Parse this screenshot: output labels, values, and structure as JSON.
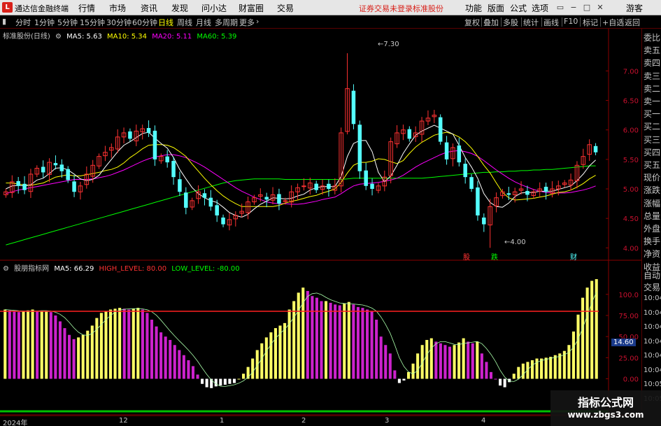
{
  "app": {
    "logo": "L",
    "title": "通达信金融终端"
  },
  "menu": [
    "行情",
    "市场",
    "资讯",
    "发现",
    "问小达",
    "财富圈",
    "交易"
  ],
  "status": {
    "login": "证券交易未登录",
    "stock": "标准股份"
  },
  "right_menu": [
    "功能",
    "版面",
    "公式",
    "选项"
  ],
  "guest": "游客",
  "periods": [
    {
      "label": "分时",
      "active": false
    },
    {
      "label": "1分钟",
      "active": false
    },
    {
      "label": "5分钟",
      "active": false
    },
    {
      "label": "15分钟",
      "active": false
    },
    {
      "label": "30分钟",
      "active": false
    },
    {
      "label": "60分钟",
      "active": false
    },
    {
      "label": "日线",
      "active": true
    },
    {
      "label": "周线",
      "active": false
    },
    {
      "label": "月线",
      "active": false
    },
    {
      "label": "多周期",
      "active": false
    },
    {
      "label": "更多",
      "active": false
    }
  ],
  "tools": [
    "复权",
    "叠加",
    "多股",
    "统计",
    "画线",
    "F10",
    "标记",
    "+自选",
    "返回"
  ],
  "main_legend": {
    "title": "标准股份(日线)",
    "ma5": "MA5: 5.63",
    "ma10": "MA10: 5.34",
    "ma20": "MA20: 5.11",
    "ma60": "MA60: 5.39"
  },
  "indicator_legend": {
    "title": "股朋指标网",
    "ma5": "MA5: 66.29",
    "high": "HIGH_LEVEL: 80.00",
    "low": "LOW_LEVEL: -80.00"
  },
  "annotations": {
    "high_price": "7.30",
    "low_price": "4.00",
    "tag1": "股",
    "tag2": "跌",
    "tag3": "财"
  },
  "sidebar": [
    "委比",
    "卖五",
    "卖四",
    "卖三",
    "卖二",
    "卖一",
    "买一",
    "买二",
    "买三",
    "买四",
    "买五",
    "现价",
    "涨跌",
    "涨幅",
    "总量",
    "外盘",
    "换手",
    "净资",
    "收益"
  ],
  "sidebar_trade": [
    "自动",
    "交易"
  ],
  "sidebar_times": [
    "10:04",
    "10:04",
    "10:04",
    "10:04",
    "10:04",
    "10:04",
    "10:05",
    "10:05"
  ],
  "indicator_current": "14.60",
  "time_axis": [
    "2024年",
    "12",
    "1",
    "2",
    "3",
    "4"
  ],
  "watermark": {
    "line1": "指标公式网",
    "line2": "www.zbgs3.com"
  },
  "colors": {
    "up": "#ff3232",
    "down": "#54ffff",
    "ma5": "#ffffff",
    "ma10": "#ffff00",
    "ma20": "#ff00ff",
    "ma60": "#00ff00",
    "bar_yellow": "#ffff66",
    "bar_magenta": "#cc22cc",
    "bar_white": "#ffffff",
    "level_line": "#ff2020"
  },
  "chart_data": {
    "type": "candlestick",
    "price_axis": {
      "ticks": [
        7.0,
        6.5,
        6.0,
        5.5,
        5.0,
        4.5,
        4.0
      ],
      "tick_labels": [
        "7.00",
        "6.50",
        "6.00",
        "5.50",
        "5.00",
        "4.50",
        "4.00"
      ],
      "range": [
        3.85,
        7.55
      ]
    },
    "indicator_axis": {
      "ticks": [
        100,
        75,
        50,
        25,
        0
      ],
      "tick_labels": [
        "100.0",
        "75.00",
        "50.00",
        "25.00",
        "0.00"
      ],
      "range": [
        -12,
        128
      ],
      "high_level": 80,
      "low_level": -80
    },
    "closes": [
      4.95,
      5.12,
      5.05,
      4.98,
      5.25,
      5.35,
      5.28,
      5.45,
      5.4,
      5.3,
      5.15,
      4.95,
      5.05,
      5.25,
      5.4,
      5.55,
      5.62,
      5.7,
      5.88,
      5.95,
      5.85,
      5.98,
      6.02,
      5.95,
      5.5,
      5.55,
      5.45,
      5.2,
      4.95,
      4.68,
      4.8,
      4.95,
      4.85,
      4.7,
      4.55,
      4.4,
      4.48,
      4.55,
      4.62,
      4.78,
      4.85,
      4.9,
      4.82,
      4.9,
      4.75,
      4.8,
      4.95,
      5.02,
      5.05,
      5.1,
      4.98,
      5.05,
      5.0,
      5.05,
      5.95,
      6.7,
      6.1,
      5.3,
      5.05,
      5.0,
      5.05,
      5.2,
      5.8,
      5.95,
      6.0,
      5.85,
      5.95,
      6.15,
      6.2,
      6.25,
      5.8,
      5.5,
      5.7,
      5.45,
      5.2,
      5.0,
      4.55,
      4.4,
      4.7,
      4.85,
      4.95,
      4.9,
      4.95,
      5.0,
      4.9,
      4.95,
      5.0,
      4.95,
      5.0,
      5.05,
      5.1,
      5.15,
      5.4,
      5.55,
      5.75,
      5.62
    ],
    "ma5": [
      5.0,
      5.05,
      5.06,
      5.05,
      5.07,
      5.15,
      5.18,
      5.26,
      5.35,
      5.36,
      5.32,
      5.25,
      5.17,
      5.14,
      5.16,
      5.23,
      5.37,
      5.5,
      5.63,
      5.74,
      5.8,
      5.87,
      5.94,
      5.96,
      5.86,
      5.77,
      5.69,
      5.53,
      5.33,
      5.17,
      5.02,
      4.92,
      4.85,
      4.8,
      4.77,
      4.69,
      4.6,
      4.55,
      4.52,
      4.57,
      4.66,
      4.74,
      4.79,
      4.85,
      4.84,
      4.83,
      4.84,
      4.88,
      4.91,
      4.98,
      5.02,
      5.04,
      5.04,
      5.04,
      5.21,
      5.55,
      5.77,
      5.82,
      5.82,
      5.63,
      5.28,
      5.12,
      5.22,
      5.4,
      5.6,
      5.76,
      5.91,
      5.98,
      6.03,
      6.08,
      6.03,
      5.98,
      5.93,
      5.74,
      5.53,
      5.37,
      5.18,
      4.92,
      4.77,
      4.7,
      4.69,
      4.76,
      4.87,
      4.93,
      4.94,
      4.94,
      4.96,
      4.96,
      4.96,
      4.99,
      5.02,
      5.05,
      5.14,
      5.25,
      5.39,
      5.49
    ],
    "ma10": [
      5.1,
      5.1,
      5.08,
      5.07,
      5.06,
      5.08,
      5.1,
      5.15,
      5.2,
      5.22,
      5.24,
      5.22,
      5.22,
      5.24,
      5.26,
      5.28,
      5.31,
      5.33,
      5.37,
      5.44,
      5.53,
      5.6,
      5.68,
      5.74,
      5.75,
      5.75,
      5.74,
      5.7,
      5.63,
      5.55,
      5.42,
      5.3,
      5.18,
      5.07,
      4.97,
      4.88,
      4.81,
      4.75,
      4.7,
      4.7,
      4.7,
      4.7,
      4.7,
      4.7,
      4.72,
      4.76,
      4.79,
      4.81,
      4.84,
      4.87,
      4.89,
      4.93,
      4.96,
      5.0,
      5.11,
      5.27,
      5.4,
      5.45,
      5.45,
      5.47,
      5.51,
      5.5,
      5.46,
      5.43,
      5.48,
      5.6,
      5.71,
      5.79,
      5.85,
      5.91,
      5.94,
      5.96,
      5.93,
      5.88,
      5.8,
      5.69,
      5.55,
      5.4,
      5.27,
      5.1,
      4.94,
      4.85,
      4.81,
      4.82,
      4.83,
      4.84,
      4.86,
      4.88,
      4.91,
      4.94,
      4.95,
      4.98,
      5.03,
      5.09,
      5.17,
      5.23
    ],
    "ma20": [
      4.92,
      4.95,
      4.98,
      5.0,
      5.02,
      5.04,
      5.06,
      5.08,
      5.1,
      5.12,
      5.14,
      5.16,
      5.16,
      5.16,
      5.17,
      5.19,
      5.21,
      5.24,
      5.28,
      5.32,
      5.37,
      5.42,
      5.47,
      5.51,
      5.54,
      5.56,
      5.58,
      5.58,
      5.56,
      5.53,
      5.48,
      5.43,
      5.37,
      5.3,
      5.23,
      5.16,
      5.09,
      5.02,
      4.96,
      4.91,
      4.86,
      4.82,
      4.78,
      4.76,
      4.75,
      4.75,
      4.74,
      4.74,
      4.75,
      4.77,
      4.79,
      4.82,
      4.84,
      4.86,
      4.92,
      4.99,
      5.05,
      5.08,
      5.09,
      5.1,
      5.11,
      5.13,
      5.15,
      5.18,
      5.23,
      5.3,
      5.37,
      5.43,
      5.48,
      5.53,
      5.58,
      5.62,
      5.64,
      5.65,
      5.63,
      5.6,
      5.55,
      5.48,
      5.4,
      5.32,
      5.25,
      5.18,
      5.12,
      5.07,
      5.03,
      4.99,
      4.96,
      4.94,
      4.93,
      4.93,
      4.93,
      4.94,
      4.96,
      4.98,
      5.01,
      5.05
    ],
    "ma60": [
      4.05,
      4.08,
      4.11,
      4.14,
      4.17,
      4.2,
      4.23,
      4.26,
      4.29,
      4.32,
      4.35,
      4.38,
      4.41,
      4.44,
      4.47,
      4.5,
      4.53,
      4.56,
      4.59,
      4.62,
      4.65,
      4.68,
      4.71,
      4.74,
      4.77,
      4.8,
      4.83,
      4.86,
      4.89,
      4.92,
      4.95,
      4.98,
      5.01,
      5.04,
      5.07,
      5.1,
      5.12,
      5.14,
      5.15,
      5.16,
      5.17,
      5.17,
      5.17,
      5.17,
      5.17,
      5.16,
      5.16,
      5.16,
      5.16,
      5.16,
      5.16,
      5.16,
      5.16,
      5.16,
      5.16,
      5.17,
      5.18,
      5.18,
      5.18,
      5.18,
      5.18,
      5.18,
      5.18,
      5.18,
      5.18,
      5.18,
      5.18,
      5.18,
      5.19,
      5.2,
      5.21,
      5.22,
      5.23,
      5.24,
      5.25,
      5.26,
      5.27,
      5.28,
      5.28,
      5.29,
      5.29,
      5.3,
      5.3,
      5.31,
      5.31,
      5.32,
      5.32,
      5.33,
      5.33,
      5.34,
      5.35,
      5.36,
      5.37,
      5.38,
      5.39,
      5.39
    ],
    "indicator": [
      82,
      81,
      80,
      79,
      80,
      81,
      82,
      80,
      80,
      80,
      79,
      75,
      68,
      60,
      52,
      47,
      49,
      52,
      57,
      63,
      72,
      78,
      80,
      82,
      83,
      84,
      83,
      82,
      83,
      84,
      82,
      78,
      70,
      62,
      55,
      50,
      46,
      40,
      34,
      28,
      22,
      15,
      5,
      -6,
      -10,
      -11,
      -9,
      -8,
      -7,
      -6,
      -5,
      0,
      6,
      14,
      24,
      34,
      42,
      49,
      55,
      60,
      63,
      66,
      82,
      92,
      102,
      108,
      104,
      98,
      96,
      92,
      92,
      90,
      88,
      87,
      89,
      91,
      88,
      85,
      84,
      82,
      80,
      70,
      50,
      40,
      30,
      10,
      -5,
      -2,
      8,
      18,
      30,
      40,
      46,
      48,
      44,
      42,
      40,
      38,
      40,
      43,
      48,
      44,
      42,
      44,
      30,
      20,
      8,
      0,
      -8,
      -10,
      -4,
      6,
      14,
      18,
      20,
      22,
      24,
      24,
      25,
      26,
      28,
      30,
      33,
      40,
      56,
      76,
      96,
      108,
      116,
      118
    ]
  }
}
